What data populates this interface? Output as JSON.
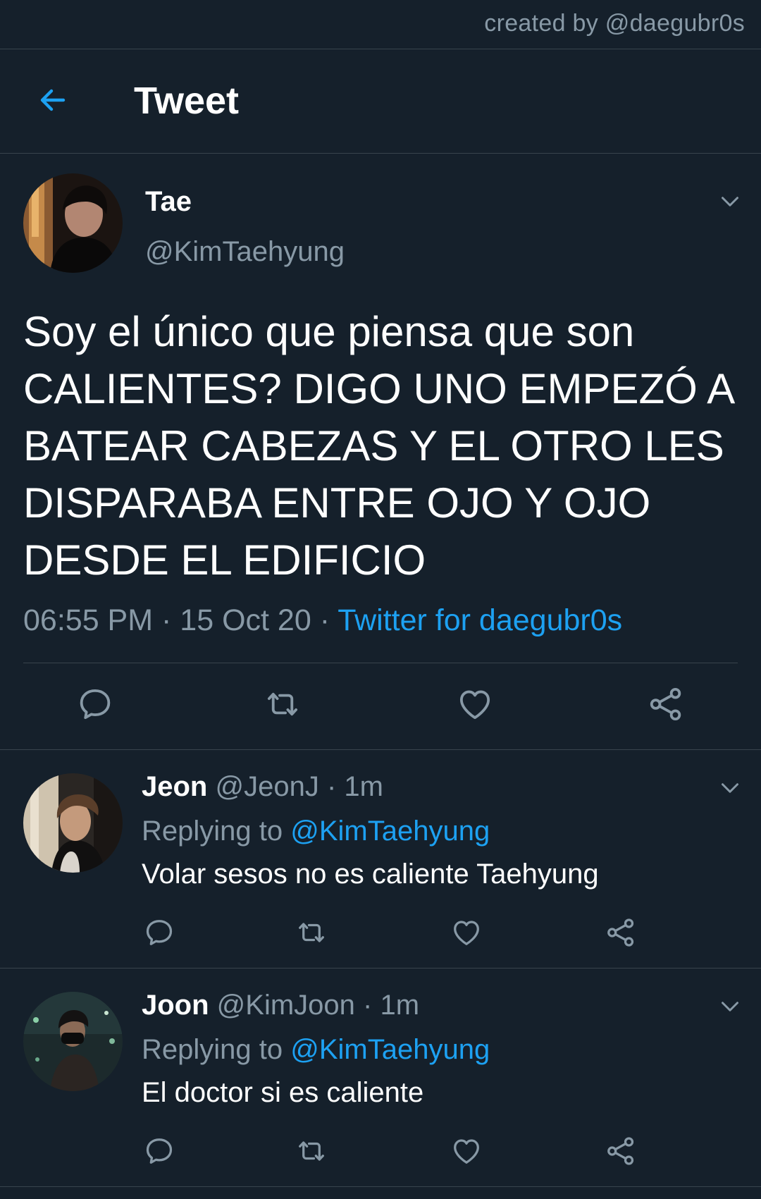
{
  "credit": "created by @daegubr0s",
  "header": {
    "back_icon": "arrow-left-icon",
    "title": "Tweet"
  },
  "colors": {
    "background": "#15202b",
    "accent": "#1da1f2",
    "secondary_text": "#8899a6",
    "divider": "#38444d"
  },
  "main_tweet": {
    "name": "Tae",
    "handle": "@KimTaehyung",
    "text": "Soy el único que piensa que son CALIENTES? DIGO UNO EMPEZÓ A BATEAR CABEZAS Y EL OTRO LES DISPARABA ENTRE OJO Y OJO DESDE EL EDIFICIO",
    "time": "06:55 PM",
    "separator": "·",
    "date": "15 Oct 20",
    "source": "Twitter for daegubr0s",
    "actions": [
      "reply-icon",
      "retweet-icon",
      "like-icon",
      "share-icon"
    ]
  },
  "replies": [
    {
      "name": "Jeon",
      "handle": "@JeonJ",
      "time_sep": "·",
      "time": "1m",
      "replying_label": "Replying to",
      "replying_to": "@KimTaehyung",
      "text": "Volar sesos no es caliente Taehyung"
    },
    {
      "name": "Joon",
      "handle": "@KimJoon",
      "time_sep": "·",
      "time": "1m",
      "replying_label": "Replying to",
      "replying_to": "@KimTaehyung",
      "text": "El doctor si es caliente"
    }
  ]
}
